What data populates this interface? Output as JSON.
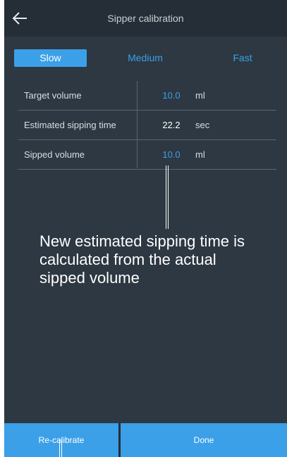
{
  "header": {
    "title": "Sipper calibration",
    "back_icon": "arrow-left-icon"
  },
  "tabs": [
    {
      "label": "Slow",
      "active": true
    },
    {
      "label": "Medium",
      "active": false
    },
    {
      "label": "Fast",
      "active": false
    }
  ],
  "rows": [
    {
      "label": "Target volume",
      "value": "10.0",
      "unit": "ml",
      "editable": true
    },
    {
      "label": "Estimated sipping time",
      "value": "22.2",
      "unit": "sec",
      "editable": false
    },
    {
      "label": "Sipped volume",
      "value": "10.0",
      "unit": "ml",
      "editable": true
    }
  ],
  "annotation": {
    "text": "New estimated sipping time is\ncalculated from the actual\nsipped volume"
  },
  "footer": {
    "recalibrate_label": "Re-calibrate",
    "done_label": "Done"
  },
  "colors": {
    "accent": "#3ba0e8",
    "background": "#2d3842",
    "titlebar": "#252e36"
  }
}
